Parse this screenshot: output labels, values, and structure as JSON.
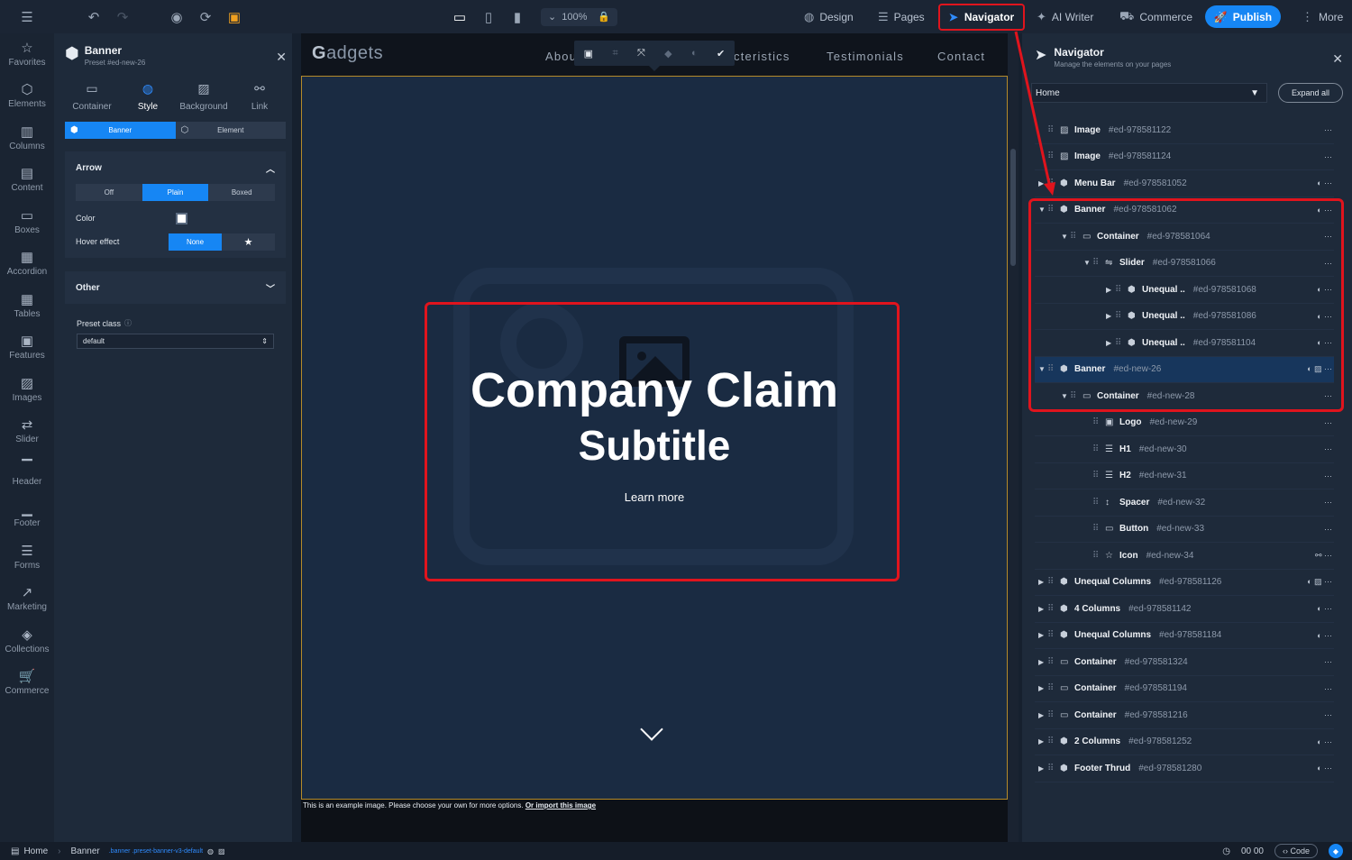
{
  "topbar": {
    "zoom": "100%",
    "design": "Design",
    "pages": "Pages",
    "navigator": "Navigator",
    "ai_writer": "AI Writer",
    "commerce": "Commerce",
    "publish": "Publish",
    "more": "More"
  },
  "rail": [
    {
      "label": "Favorites",
      "icon": "star-icon",
      "glyph": "☆"
    },
    {
      "label": "Elements",
      "icon": "cube-icon",
      "glyph": "⬡"
    },
    {
      "label": "Columns",
      "icon": "columns-icon",
      "glyph": "▥"
    },
    {
      "label": "Content",
      "icon": "document-icon",
      "glyph": "▤"
    },
    {
      "label": "Boxes",
      "icon": "box-icon",
      "glyph": "▭"
    },
    {
      "label": "Accordion",
      "icon": "accordion-icon",
      "glyph": "▦"
    },
    {
      "label": "Tables",
      "icon": "table-icon",
      "glyph": "▦"
    },
    {
      "label": "Features",
      "icon": "features-icon",
      "glyph": "▣"
    },
    {
      "label": "Images",
      "icon": "image-icon",
      "glyph": "▨"
    },
    {
      "label": "Slider",
      "icon": "slider-icon",
      "glyph": "⇄"
    },
    {
      "label": "Header",
      "icon": "header-icon",
      "glyph": "▔"
    },
    {
      "label": "Footer",
      "icon": "footer-icon",
      "glyph": "▁"
    },
    {
      "label": "Forms",
      "icon": "forms-icon",
      "glyph": "☰"
    },
    {
      "label": "Marketing",
      "icon": "marketing-icon",
      "glyph": "↗"
    },
    {
      "label": "Collections",
      "icon": "collections-icon",
      "glyph": "◈"
    },
    {
      "label": "Commerce",
      "icon": "cart-icon",
      "glyph": "🛒"
    }
  ],
  "props": {
    "title": "Banner",
    "subtitle": "Preset #ed-new-26",
    "tabs": [
      "Container",
      "Style",
      "Background",
      "Link"
    ],
    "seg_banner": "Banner",
    "seg_element": "Element",
    "arrow_title": "Arrow",
    "arrow_opts": [
      "Off",
      "Plain",
      "Boxed"
    ],
    "color_label": "Color",
    "hover_label": "Hover effect",
    "hover_none": "None",
    "other_title": "Other",
    "preset_label": "Preset class",
    "preset_value": "default"
  },
  "site": {
    "logo_g": "G",
    "logo_rest": "adgets",
    "nav_about": "Abou",
    "nav_char": "cteristics",
    "nav_testi": "Testimonials",
    "nav_contact": "Contact",
    "claim": "Company Claim",
    "subtitle": "Subtitle",
    "learn_more": "Learn more",
    "caption": "This is an example image. Please choose your own for more options.",
    "caption_link": "Or import this image"
  },
  "navigator": {
    "title": "Navigator",
    "subtitle": "Manage the elements on your pages",
    "page": "Home",
    "expand_all": "Expand all",
    "rows": [
      {
        "depth": 0,
        "caret": "",
        "glyph": "▨",
        "name": "Image",
        "id": "#ed-978581122",
        "acts": "···"
      },
      {
        "depth": 0,
        "caret": "",
        "glyph": "▨",
        "name": "Image",
        "id": "#ed-978581124",
        "acts": "···"
      },
      {
        "depth": 0,
        "caret": "▶",
        "glyph": "⬢",
        "name": "Menu Bar",
        "id": "#ed-978581052",
        "acts": "◐ ···"
      },
      {
        "depth": 0,
        "caret": "▼",
        "glyph": "⬢",
        "name": "Banner",
        "id": "#ed-978581062",
        "acts": "◐ ···"
      },
      {
        "depth": 1,
        "caret": "▼",
        "glyph": "▭",
        "name": "Container",
        "id": "#ed-978581064",
        "acts": "···"
      },
      {
        "depth": 2,
        "caret": "▼",
        "glyph": "⇋",
        "name": "Slider",
        "id": "#ed-978581066",
        "acts": "···"
      },
      {
        "depth": 3,
        "caret": "▶",
        "glyph": "⬢",
        "name": "Unequal ..",
        "id": "#ed-978581068",
        "acts": "◐ ···"
      },
      {
        "depth": 3,
        "caret": "▶",
        "glyph": "⬢",
        "name": "Unequal ..",
        "id": "#ed-978581086",
        "acts": "◐ ···"
      },
      {
        "depth": 3,
        "caret": "▶",
        "glyph": "⬢",
        "name": "Unequal ..",
        "id": "#ed-978581104",
        "acts": "◐ ···"
      },
      {
        "depth": 0,
        "caret": "▼",
        "glyph": "⬢",
        "name": "Banner",
        "id": "#ed-new-26",
        "acts": "◐ ▨ ···",
        "selected": true
      },
      {
        "depth": 1,
        "caret": "▼",
        "glyph": "▭",
        "name": "Container",
        "id": "#ed-new-28",
        "acts": "···"
      },
      {
        "depth": 2,
        "caret": "",
        "glyph": "▣",
        "name": "Logo",
        "id": "#ed-new-29",
        "acts": "···"
      },
      {
        "depth": 2,
        "caret": "",
        "glyph": "☰",
        "name": "H1",
        "id": "#ed-new-30",
        "acts": "···"
      },
      {
        "depth": 2,
        "caret": "",
        "glyph": "☰",
        "name": "H2",
        "id": "#ed-new-31",
        "acts": "···"
      },
      {
        "depth": 2,
        "caret": "",
        "glyph": "↕",
        "name": "Spacer",
        "id": "#ed-new-32",
        "acts": "···"
      },
      {
        "depth": 2,
        "caret": "",
        "glyph": "▭",
        "name": "Button",
        "id": "#ed-new-33",
        "acts": "···"
      },
      {
        "depth": 2,
        "caret": "",
        "glyph": "☆",
        "name": "Icon",
        "id": "#ed-new-34",
        "acts": "⚯ ···"
      },
      {
        "depth": 0,
        "caret": "▶",
        "glyph": "⬢",
        "name": "Unequal Columns",
        "id": "#ed-978581126",
        "acts": "◐ ▨ ···"
      },
      {
        "depth": 0,
        "caret": "▶",
        "glyph": "⬢",
        "name": "4 Columns",
        "id": "#ed-978581142",
        "acts": "◐ ···"
      },
      {
        "depth": 0,
        "caret": "▶",
        "glyph": "⬢",
        "name": "Unequal Columns",
        "id": "#ed-978581184",
        "acts": "◐ ···"
      },
      {
        "depth": 0,
        "caret": "▶",
        "glyph": "▭",
        "name": "Container",
        "id": "#ed-978581324",
        "acts": "···"
      },
      {
        "depth": 0,
        "caret": "▶",
        "glyph": "▭",
        "name": "Container",
        "id": "#ed-978581194",
        "acts": "···"
      },
      {
        "depth": 0,
        "caret": "▶",
        "glyph": "▭",
        "name": "Container",
        "id": "#ed-978581216",
        "acts": "···"
      },
      {
        "depth": 0,
        "caret": "▶",
        "glyph": "⬢",
        "name": "2 Columns",
        "id": "#ed-978581252",
        "acts": "◐ ···"
      },
      {
        "depth": 0,
        "caret": "▶",
        "glyph": "⬢",
        "name": "Footer Thrud",
        "id": "#ed-978581280",
        "acts": "◐ ···"
      }
    ]
  },
  "status": {
    "home": "Home",
    "banner": "Banner",
    "classes": ".banner .preset-banner-v3-default",
    "time": "00 00",
    "code": "Code"
  },
  "colors": {
    "accent": "#1686f4",
    "highlight": "#e0141d",
    "selected_row": "#17365c"
  }
}
